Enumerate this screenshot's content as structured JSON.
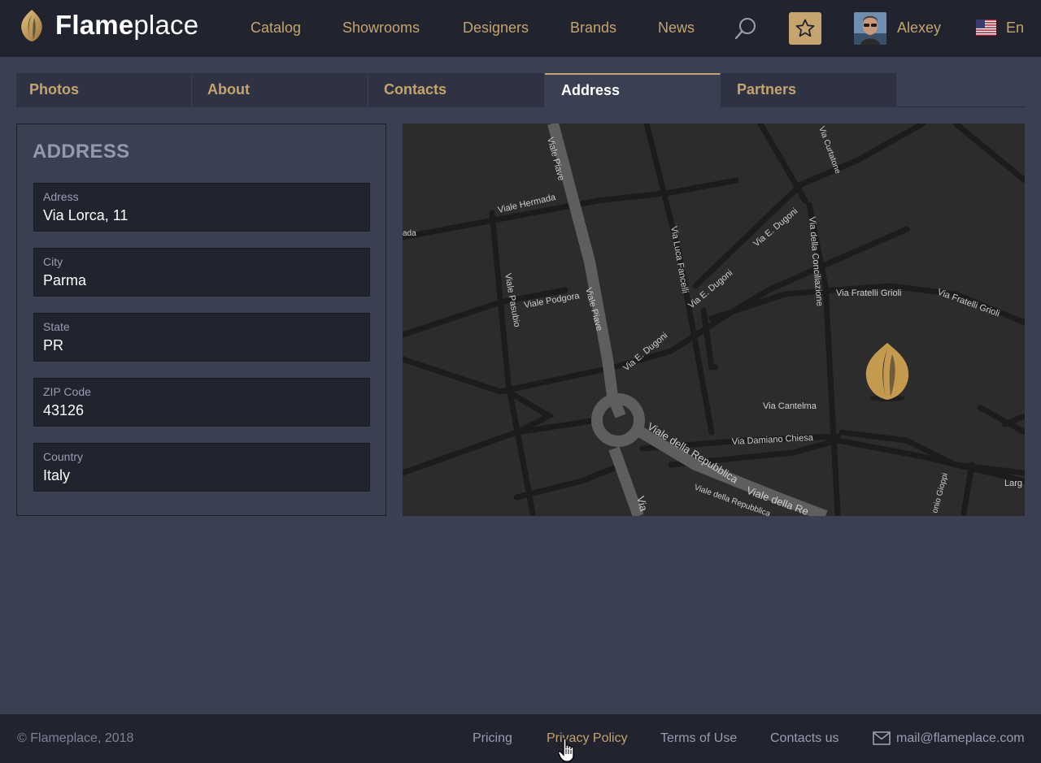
{
  "brand": {
    "name_bold": "Flame",
    "name_light": "place"
  },
  "nav": {
    "items": [
      "Catalog",
      "Showrooms",
      "Designers",
      "Brands",
      "News"
    ],
    "user": "Alexey",
    "language": "En"
  },
  "tabs": {
    "items": [
      "Photos",
      "About",
      "Contacts",
      "Address",
      "Partners"
    ],
    "active": "Address"
  },
  "address": {
    "title": "ADDRESS",
    "fields": [
      {
        "label": "Adress",
        "value": "Via Lorca, 11"
      },
      {
        "label": "City",
        "value": "Parma"
      },
      {
        "label": "State",
        "value": "PR"
      },
      {
        "label": "ZIP Code",
        "value": "43126"
      },
      {
        "label": "Country",
        "value": "Italy"
      }
    ]
  },
  "map": {
    "streets": [
      "Viale Piave",
      "Viale Hermada",
      "Via Luca Fancelli",
      "Via E. Dugoni",
      "Via della Conciliazione",
      "Via Fratelli Grioli",
      "Viale Pasubio",
      "Viale Podgora",
      "Via Cantelma",
      "Via Damiano Chiesa",
      "Viale della Repubblica",
      "Via Curtatone",
      "onio Gioppi",
      "ada",
      "Larg"
    ]
  },
  "footer": {
    "copyright": "© Flameplace, 2018",
    "links": [
      "Pricing",
      "Privacy Policy",
      "Terms of Use",
      "Contacts us"
    ],
    "active_link": "Privacy Policy",
    "email": "mail@flameplace.com"
  },
  "colors": {
    "accent": "#c5a46d",
    "header_bg": "#21232f",
    "page_bg": "#3b3f52"
  },
  "icons": [
    "flame-logo-icon",
    "search-icon",
    "star-icon",
    "us-flag-icon",
    "mail-icon",
    "map-pin-icon"
  ]
}
